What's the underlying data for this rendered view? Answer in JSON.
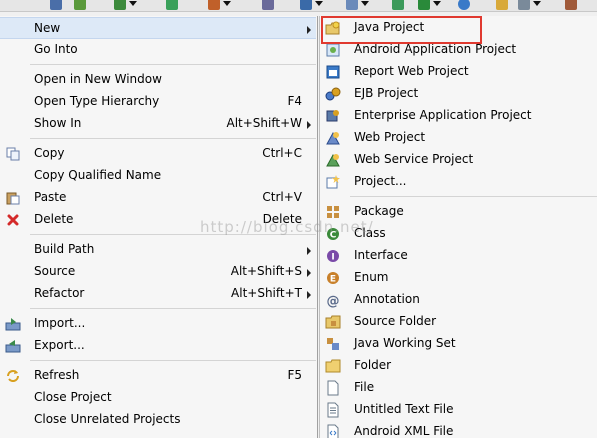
{
  "menu": {
    "items": [
      {
        "label": "New",
        "accel": "",
        "submenu": true,
        "icon": "new"
      },
      {
        "label": "Go Into",
        "accel": "",
        "icon": ""
      },
      {
        "label": "Open in New Window",
        "accel": "",
        "icon": ""
      },
      {
        "label": "Open Type Hierarchy",
        "accel": "F4",
        "icon": ""
      },
      {
        "label": "Show In",
        "accel": "Alt+Shift+W",
        "submenu": true,
        "icon": ""
      },
      {
        "label": "Copy",
        "accel": "Ctrl+C",
        "icon": "copy"
      },
      {
        "label": "Copy Qualified Name",
        "accel": "",
        "icon": ""
      },
      {
        "label": "Paste",
        "accel": "Ctrl+V",
        "icon": "paste"
      },
      {
        "label": "Delete",
        "accel": "Delete",
        "icon": "delete"
      },
      {
        "label": "Build Path",
        "accel": "",
        "submenu": true,
        "icon": ""
      },
      {
        "label": "Source",
        "accel": "Alt+Shift+S",
        "submenu": true,
        "icon": ""
      },
      {
        "label": "Refactor",
        "accel": "Alt+Shift+T",
        "submenu": true,
        "icon": ""
      },
      {
        "label": "Import...",
        "accel": "",
        "icon": "import"
      },
      {
        "label": "Export...",
        "accel": "",
        "icon": "export"
      },
      {
        "label": "Refresh",
        "accel": "F5",
        "icon": "refresh"
      },
      {
        "label": "Close Project",
        "accel": "",
        "icon": ""
      },
      {
        "label": "Close Unrelated Projects",
        "accel": "",
        "icon": ""
      }
    ]
  },
  "submenu": {
    "items": [
      {
        "label": "Java Project",
        "icon": "java-project"
      },
      {
        "label": "Android Application Project",
        "icon": "android-app"
      },
      {
        "label": "Report Web Project",
        "icon": "report-web"
      },
      {
        "label": "EJB Project",
        "icon": "ejb"
      },
      {
        "label": "Enterprise Application Project",
        "icon": "enterprise"
      },
      {
        "label": "Web Project",
        "icon": "web-project"
      },
      {
        "label": "Web Service Project",
        "icon": "web-service"
      },
      {
        "label": "Project...",
        "icon": "project"
      },
      {
        "label": "Package",
        "icon": "package"
      },
      {
        "label": "Class",
        "icon": "class"
      },
      {
        "label": "Interface",
        "icon": "interface"
      },
      {
        "label": "Enum",
        "icon": "enum"
      },
      {
        "label": "Annotation",
        "icon": "annotation"
      },
      {
        "label": "Source Folder",
        "icon": "source-folder"
      },
      {
        "label": "Java Working Set",
        "icon": "working-set"
      },
      {
        "label": "Folder",
        "icon": "folder"
      },
      {
        "label": "File",
        "icon": "file"
      },
      {
        "label": "Untitled Text File",
        "icon": "text-file"
      },
      {
        "label": "Android XML File",
        "icon": "xml-file"
      }
    ]
  },
  "watermark": "http://blog.csdn.net/",
  "colors": {
    "highlight": "#e0392f",
    "active_row": "#dde9f7"
  }
}
